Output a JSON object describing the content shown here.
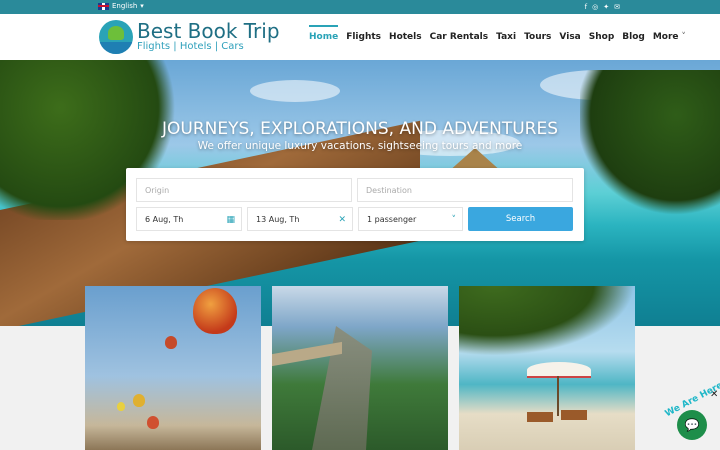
{
  "topbar": {
    "language": "English",
    "social_icons": [
      "facebook-icon",
      "instagram-icon",
      "twitter-icon",
      "email-icon"
    ]
  },
  "brand": {
    "name": "Best Book Trip",
    "tagline": "Flights | Hotels | Cars"
  },
  "nav": {
    "items": [
      "Home",
      "Flights",
      "Hotels",
      "Car Rentals",
      "Taxi",
      "Tours",
      "Visa",
      "Shop",
      "Blog",
      "More"
    ],
    "active": "Home"
  },
  "hero": {
    "title": "JOURNEYS, EXPLORATIONS, AND ADVENTURES",
    "subtitle": "We offer unique luxury vacations, sightseeing tours and more"
  },
  "search": {
    "origin_placeholder": "Origin",
    "destination_placeholder": "Destination",
    "depart_date": "6 Aug, Th",
    "return_date": "13 Aug, Th",
    "passengers": "1 passenger",
    "button_label": "Search"
  },
  "chat_widget": {
    "tag": "We Are Here!",
    "close_symbol": "✕"
  },
  "colors": {
    "topbar": "#2a8a9a",
    "accent": "#2aa3b7",
    "search_button": "#3aa7df",
    "chat": "#1e8e4a"
  }
}
